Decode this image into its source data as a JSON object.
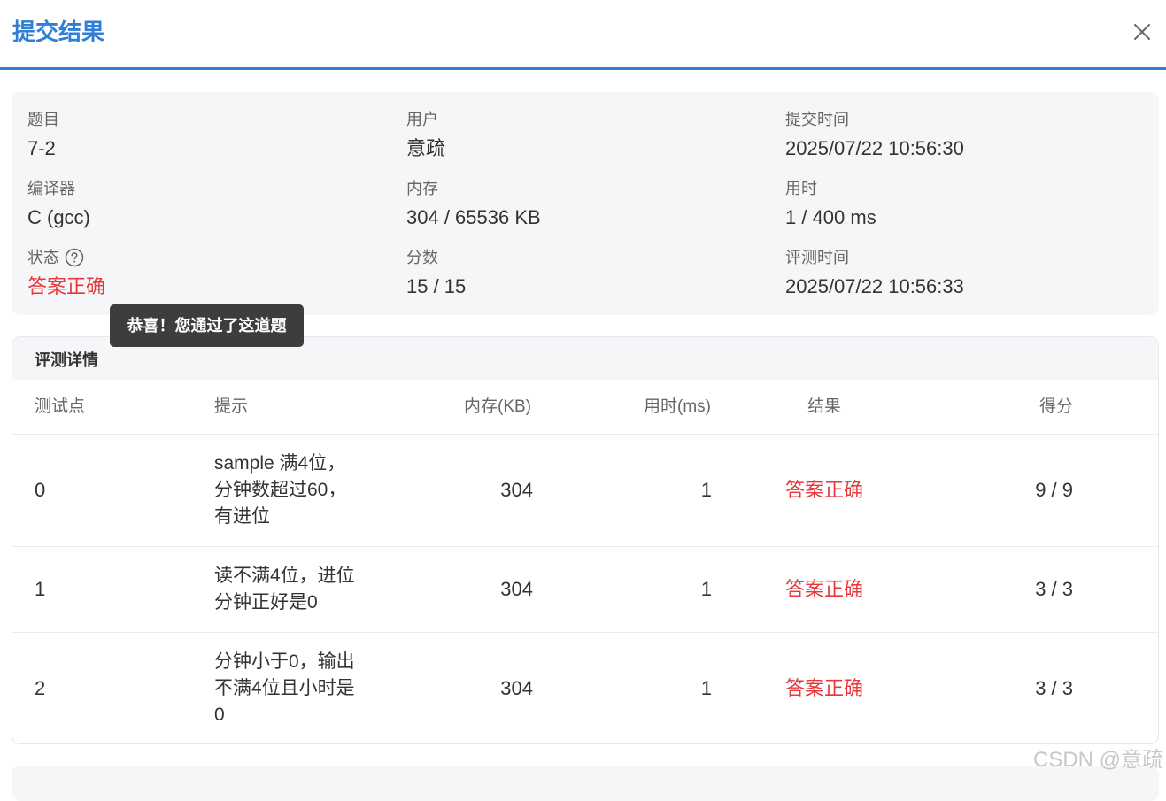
{
  "modal": {
    "title": "提交结果"
  },
  "info": {
    "problem_label": "题目",
    "problem_value": "7-2",
    "user_label": "用户",
    "user_value": "意疏",
    "submit_time_label": "提交时间",
    "submit_time_value": "2025/07/22 10:56:30",
    "compiler_label": "编译器",
    "compiler_value": "C (gcc)",
    "memory_label": "内存",
    "memory_value": "304 / 65536 KB",
    "time_label": "用时",
    "time_value": "1 / 400 ms",
    "status_label": "状态",
    "status_value": "答案正确",
    "score_label": "分数",
    "score_value": "15 / 15",
    "judge_time_label": "评测时间",
    "judge_time_value": "2025/07/22 10:56:33"
  },
  "tooltip": {
    "text": "恭喜！您通过了这道题"
  },
  "details": {
    "title": "评测详情",
    "columns": {
      "case": "测试点",
      "hint": "提示",
      "memory": "内存(KB)",
      "time": "用时(ms)",
      "result": "结果",
      "score": "得分"
    },
    "rows": [
      {
        "case": "0",
        "hint": "sample 满4位，分钟数超过60，有进位",
        "memory": "304",
        "time": "1",
        "result": "答案正确",
        "score": "9 / 9"
      },
      {
        "case": "1",
        "hint": "读不满4位，进位分钟正好是0",
        "memory": "304",
        "time": "1",
        "result": "答案正确",
        "score": "3 / 3"
      },
      {
        "case": "2",
        "hint": "分钟小于0，输出不满4位且小时是0",
        "memory": "304",
        "time": "1",
        "result": "答案正确",
        "score": "3 / 3"
      }
    ]
  },
  "watermark": "CSDN @意疏",
  "colors": {
    "accent": "#2f7fd6",
    "success_text": "#e8363a",
    "card_bg": "#f5f6f8"
  }
}
